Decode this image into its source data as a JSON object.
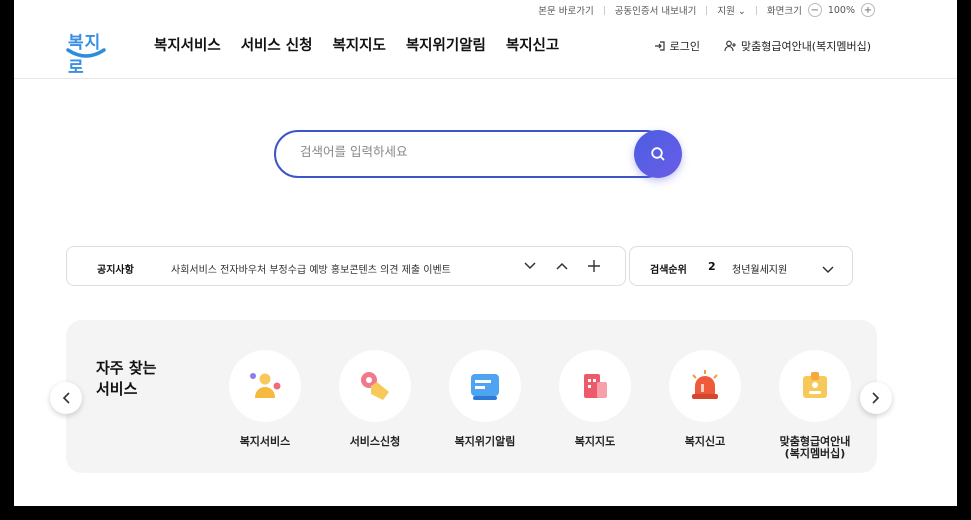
{
  "utility": {
    "links": [
      "본문 바로가기",
      "공동인증서 내보내기"
    ],
    "language": "지원",
    "zoom_label": "화면크기",
    "zoom_value": "100%",
    "zoom_minus": "−",
    "zoom_plus": "+"
  },
  "header": {
    "logo_text": "복지로",
    "nav": [
      "복지서비스",
      "서비스 신청",
      "복지지도",
      "복지위기알림",
      "복지신고"
    ],
    "login": "로그인",
    "membership": "맞춤형급여안내(복지멤버십)"
  },
  "search": {
    "placeholder": "검색어를 입력하세요"
  },
  "notice": {
    "label": "공지사항",
    "text": "사회서비스 전자바우처 부정수급 예방 홍보콘텐츠 의견 제출 이벤트"
  },
  "rank": {
    "label": "검색순위",
    "number": "2",
    "item": "청년월세지원"
  },
  "frequent": {
    "title_line1": "자주 찾는",
    "title_line2": "서비스",
    "services": [
      {
        "name": "복지서비스",
        "icon": "person-icon"
      },
      {
        "name": "서비스신청",
        "icon": "hand-pointer-icon"
      },
      {
        "name": "복지위기알림",
        "icon": "message-icon"
      },
      {
        "name": "복지지도",
        "icon": "map-building-icon"
      },
      {
        "name": "복지신고",
        "icon": "siren-icon"
      },
      {
        "name": "맞춤형급여안내\n(복지멤버십)",
        "name_line1": "맞춤형급여안내",
        "name_line2": "(복지멤버십)",
        "icon": "badge-icon"
      }
    ]
  }
}
